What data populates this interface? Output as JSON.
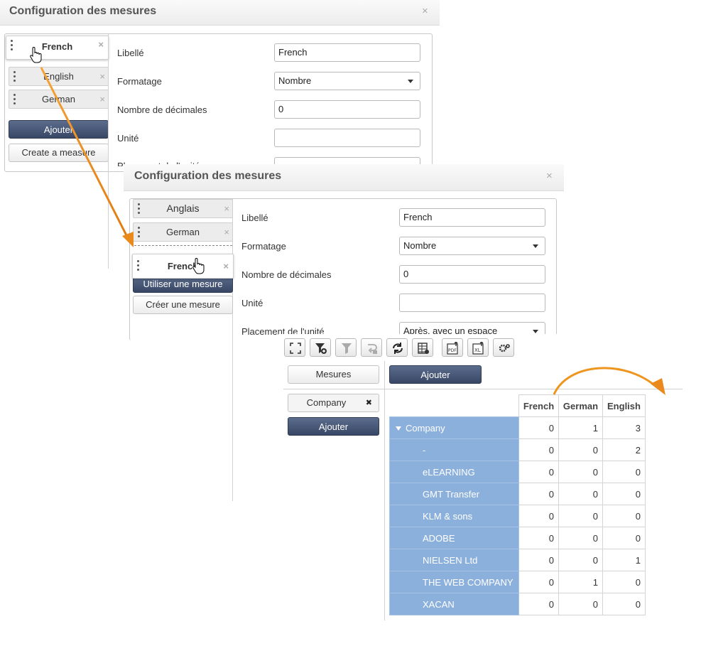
{
  "dialog1": {
    "title": "Configuration des mesures",
    "close": "×",
    "measures": [
      "French",
      "English",
      "German"
    ],
    "add_button": "Ajouter",
    "create_button": "Create a measure",
    "fields": {
      "label_title": "Libellé",
      "label_value": "French",
      "format_title": "Formatage",
      "format_value": "Nombre",
      "decimals_title": "Nombre de décimales",
      "decimals_value": "0",
      "unit_title": "Unité",
      "unit_value": "",
      "placement_title_partial": "Placement de l'unité"
    }
  },
  "dialog2": {
    "title": "Configuration des mesures",
    "close": "×",
    "measures": [
      "Anglais",
      "German",
      "French"
    ],
    "use_button": "Utiliser une mesure",
    "create_button": "Créer une mesure",
    "fields": {
      "label_title": "Libellé",
      "label_value": "French",
      "format_title": "Formatage",
      "format_value": "Nombre",
      "decimals_title": "Nombre de décimales",
      "decimals_value": "0",
      "unit_title": "Unité",
      "unit_value": "",
      "placement_title": "Placement de l'unité",
      "placement_value": "Après, avec un espace"
    }
  },
  "pivot": {
    "toolbar_icons": [
      "fullscreen-icon",
      "add-filter-icon",
      "filter-icon",
      "drill-icon",
      "refresh-icon",
      "table-settings-icon",
      "export-pdf-icon",
      "export-excel-icon",
      "settings-icon"
    ],
    "measures_button": "Mesures",
    "add_column_button": "Ajouter",
    "dimension_chip": "Company",
    "dimension_chip_remove": "✖",
    "add_row_button": "Ajouter",
    "columns": [
      "French",
      "German",
      "English"
    ],
    "rows": [
      {
        "label": "Company",
        "values": [
          "0",
          "1",
          "3"
        ]
      },
      {
        "label": "-",
        "values": [
          "0",
          "0",
          "2"
        ]
      },
      {
        "label": "eLEARNING",
        "values": [
          "0",
          "0",
          "0"
        ]
      },
      {
        "label": "GMT Transfer",
        "values": [
          "0",
          "0",
          "0"
        ]
      },
      {
        "label": "KLM & sons",
        "values": [
          "0",
          "0",
          "0"
        ]
      },
      {
        "label": "ADOBE",
        "values": [
          "0",
          "0",
          "0"
        ]
      },
      {
        "label": "NIELSEN Ltd",
        "values": [
          "0",
          "0",
          "1"
        ]
      },
      {
        "label": "THE WEB COMPANY",
        "values": [
          "0",
          "1",
          "0"
        ]
      },
      {
        "label": "XACAN",
        "values": [
          "0",
          "0",
          "0"
        ]
      }
    ]
  },
  "colors": {
    "accent_arrow": "#f08c1c",
    "row_header_bg": "#8cb0dc",
    "dark_button": "#3f4d6b"
  }
}
